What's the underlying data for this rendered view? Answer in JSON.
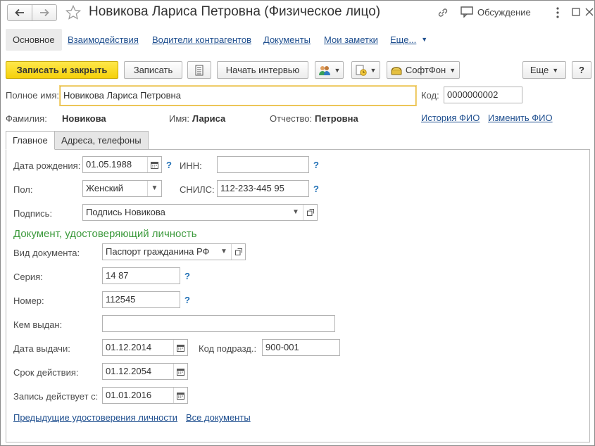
{
  "window": {
    "title": "Новикова Лариса Петровна (Физическое лицо)",
    "discussion_label": "Обсуждение"
  },
  "nav": {
    "tabs": [
      {
        "label": "Основное",
        "active": true
      },
      {
        "label": "Взаимодействия"
      },
      {
        "label": "Водители контрагентов"
      },
      {
        "label": "Документы"
      },
      {
        "label": "Мои заметки"
      },
      {
        "label": "Еще..."
      }
    ]
  },
  "toolbar": {
    "save_close": "Записать и закрыть",
    "save": "Записать",
    "start_interview": "Начать интервью",
    "softfon": "СофтФон",
    "more": "Еще",
    "help": "?"
  },
  "header": {
    "full_name_label": "Полное имя:",
    "full_name_value": "Новикова Лариса Петровна",
    "code_label": "Код:",
    "code_value": "0000000002",
    "surname_label": "Фамилия:",
    "surname_value": "Новикова",
    "name_label": "Имя:",
    "name_value": "Лариса",
    "patronymic_label": "Отчество:",
    "patronymic_value": "Петровна",
    "history_link": "История ФИО",
    "change_link": "Изменить ФИО"
  },
  "tabs": {
    "main": "Главное",
    "addresses": "Адреса, телефоны"
  },
  "main": {
    "birth_label": "Дата рождения:",
    "birth_value": "01.05.1988",
    "inn_label": "ИНН:",
    "inn_value": "",
    "gender_label": "Пол:",
    "gender_value": "Женский",
    "snils_label": "СНИЛС:",
    "snils_value": "112-233-445 95",
    "signature_label": "Подпись:",
    "signature_value": "Подпись Новикова",
    "doc_section_title": "Документ, удостоверяющий личность",
    "doc_type_label": "Вид документа:",
    "doc_type_value": "Паспорт гражданина РФ",
    "series_label": "Серия:",
    "series_value": "14 87",
    "number_label": "Номер:",
    "number_value": "112545",
    "issued_by_label": "Кем выдан:",
    "issued_by_value": "",
    "issue_date_label": "Дата выдачи:",
    "issue_date_value": "01.12.2014",
    "dept_code_label": "Код подразд.:",
    "dept_code_value": "900-001",
    "valid_label": "Срок действия:",
    "valid_value": "01.12.2054",
    "effective_label": "Запись действует с:",
    "effective_value": "01.01.2016",
    "prev_docs_link": "Предыдущие удостоверения личности",
    "all_docs_link": "Все документы",
    "help_mark": "?"
  },
  "icons": {
    "back": "arrow-left-icon",
    "forward": "arrow-right-icon",
    "favorite": "star-icon",
    "link": "link-icon",
    "discussion": "chat-icon",
    "menu": "more-vert-icon",
    "maximize": "maximize-icon",
    "close": "close-icon",
    "calendar": "calendar-icon",
    "open": "open-in-new-icon"
  },
  "colors": {
    "accent_yellow": "#f5d00b",
    "link_blue": "#1f4f8f",
    "section_green": "#3c9a3c",
    "help_blue": "#1f6fb5"
  }
}
